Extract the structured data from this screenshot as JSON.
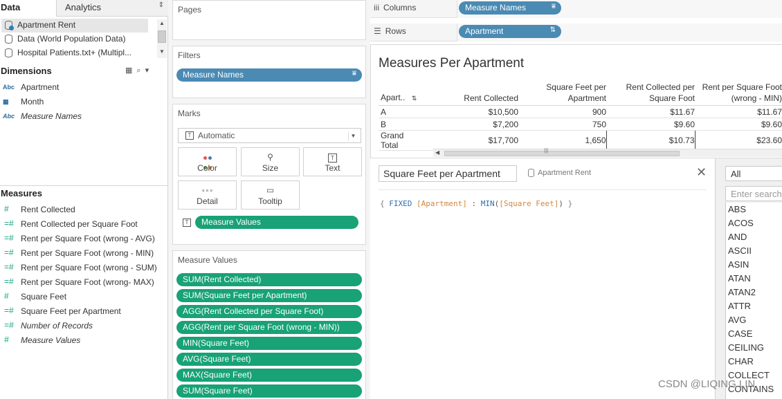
{
  "left": {
    "tabs": {
      "data": "Data",
      "analytics": "Analytics",
      "analytics_arrow": "⇕"
    },
    "datasources": [
      "Apartment Rent",
      "Data (World Population Data)",
      "Hospital Patients.txt+ (Multipl..."
    ],
    "dimensions_title": "Dimensions",
    "dimensions": [
      {
        "icon": "Abc",
        "name": "Apartment"
      },
      {
        "icon": "▦",
        "name": "Month"
      },
      {
        "icon": "Abc",
        "name": "Measure Names"
      }
    ],
    "measures_title": "Measures",
    "measures": [
      {
        "icon": "#",
        "name": "Rent Collected"
      },
      {
        "icon": "=#",
        "name": "Rent Collected per Square Foot"
      },
      {
        "icon": "=#",
        "name": "Rent per Square Foot (wrong - AVG)"
      },
      {
        "icon": "=#",
        "name": "Rent per Square Foot (wrong - MIN)"
      },
      {
        "icon": "=#",
        "name": "Rent per Square Foot (wrong - SUM)"
      },
      {
        "icon": "=#",
        "name": "Rent per Square Foot (wrong- MAX)"
      },
      {
        "icon": "#",
        "name": "Square Feet"
      },
      {
        "icon": "=#",
        "name": "Square Feet per Apartment"
      },
      {
        "icon": "=#",
        "name": "Number of Records"
      },
      {
        "icon": "#",
        "name": "Measure Values"
      }
    ]
  },
  "pages": {
    "title": "Pages"
  },
  "filters": {
    "title": "Filters",
    "pill": "Measure Names"
  },
  "marks": {
    "title": "Marks",
    "type": "Automatic",
    "buttons": {
      "color": "Color",
      "size": "Size",
      "text": "Text",
      "detail": "Detail",
      "tooltip": "Tooltip"
    },
    "pill": "Measure Values"
  },
  "measure_values": {
    "title": "Measure Values",
    "pills": [
      "SUM(Rent Collected)",
      "SUM(Square Feet per Apartment)",
      "AGG(Rent Collected per Square Foot)",
      "AGG(Rent per Square Foot (wrong - MIN))",
      "MIN(Square Feet)",
      "AVG(Square Feet)",
      "MAX(Square Feet)",
      "SUM(Square Feet)"
    ]
  },
  "shelves": {
    "columns_label": "Columns",
    "columns_pill": "Measure Names",
    "rows_label": "Rows",
    "rows_pill": "Apartment"
  },
  "view": {
    "title": "Measures Per Apartment",
    "headers": [
      "Apart..",
      "Rent Collected",
      "Square Feet per Apartment",
      "Rent Collected per Square Foot",
      "Rent per Square Foot (wrong - MIN)"
    ],
    "rows": [
      [
        "A",
        "$10,500",
        "900",
        "$11.67",
        "$11.67"
      ],
      [
        "B",
        "$7,200",
        "750",
        "$9.60",
        "$9.60"
      ],
      [
        "Grand Total",
        "$17,700",
        "1,650",
        "$10.73",
        "$23.60"
      ]
    ]
  },
  "calc": {
    "name": "Square Feet per Apartment",
    "source": "Apartment Rent",
    "close": "✕",
    "formula": {
      "open": "{ ",
      "kw1": "FIXED",
      "field1": "[Apartment]",
      "colon": " : ",
      "kw2": "MIN",
      "paren_open": "(",
      "field2": "[Square Feet]",
      "paren_close": ")",
      "close": " }"
    }
  },
  "functions": {
    "category": "All",
    "search_placeholder": "Enter search text",
    "items": [
      "ABS",
      "ACOS",
      "AND",
      "ASCII",
      "ASIN",
      "ATAN",
      "ATAN2",
      "ATTR",
      "AVG",
      "CASE",
      "CEILING",
      "CHAR",
      "COLLECT",
      "CONTAINS"
    ]
  },
  "watermark": "CSDN @LIQING LIN"
}
